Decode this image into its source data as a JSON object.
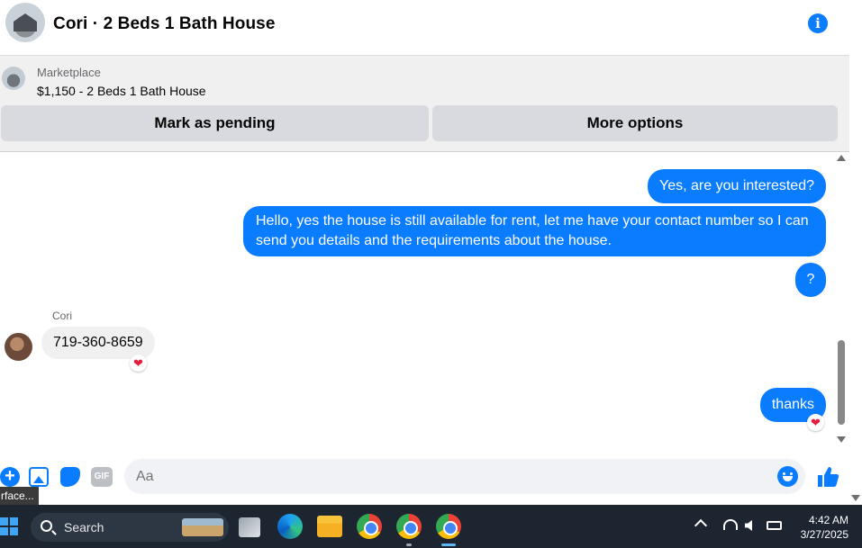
{
  "header": {
    "title": "Cori · 2 Beds 1 Bath House",
    "info_icon": "info-icon"
  },
  "banner": {
    "label": "Marketplace",
    "listing": "$1,150 - 2 Beds 1 Bath House",
    "mark_pending": "Mark as pending",
    "more_options": "More options"
  },
  "messages": {
    "outgoing": [
      "Yes, are you interested?",
      "Hello, yes the house is still available for rent, let me have your contact number so I can send you details and the requirements about the house.",
      "?",
      "thanks"
    ],
    "incoming": {
      "sender": "Cori",
      "text": "719-360-8659"
    },
    "reaction": "❤"
  },
  "composer": {
    "placeholder": "Aa",
    "gif_label": "GIF",
    "plus": "+"
  },
  "tooltip": "rface...",
  "taskbar": {
    "search": "Search",
    "time": "4:42 AM",
    "date": "3/27/2025"
  },
  "colors": {
    "messenger_blue": "#0a7cff",
    "incoming_bubble": "#f0f0f0",
    "taskbar_bg": "#1c2530"
  }
}
